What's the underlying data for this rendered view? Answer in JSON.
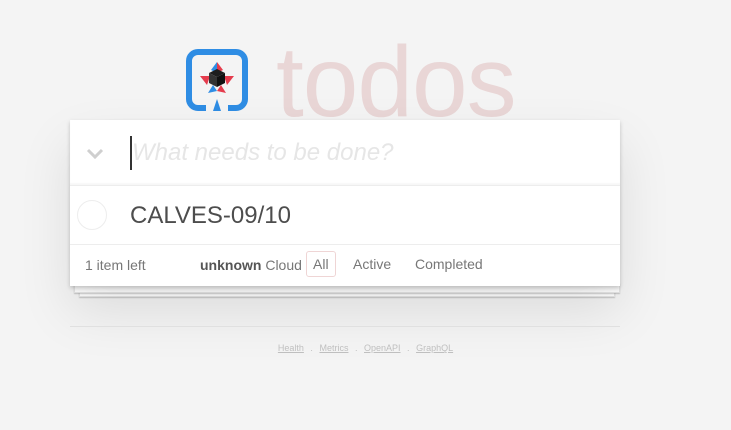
{
  "header": {
    "title": "todos"
  },
  "new_todo": {
    "placeholder": "What needs to be done?",
    "value": ""
  },
  "todos": [
    {
      "label": "CALVES-09/10",
      "completed": false
    }
  ],
  "footer": {
    "count_text": "1 item left",
    "connection_status": "unknown",
    "connection_label": "Cloud",
    "filters": [
      "All",
      "Active",
      "Completed"
    ],
    "selected_filter": "All"
  },
  "links": [
    "Health",
    "Metrics",
    "OpenAPI",
    "GraphQL"
  ],
  "link_separator": ".",
  "colors": {
    "background": "#f4f4f4",
    "title": "#efd5d5",
    "logo_blue": "#2f8de4",
    "logo_red": "#e53c4d"
  },
  "icons": {
    "logo": "quarkus-logo",
    "toggle_all": "chevron-down-icon",
    "item_toggle": "circle-checkbox-icon"
  }
}
